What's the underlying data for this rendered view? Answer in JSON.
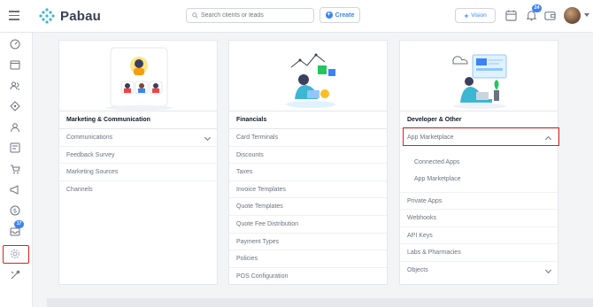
{
  "app": {
    "name": "Pabau"
  },
  "header": {
    "search_placeholder": "Search clients or leads",
    "create_label": "Create",
    "vision_label": "Vision",
    "notification_count": "24",
    "icons": [
      "menu-icon",
      "calendar-icon",
      "bell-icon",
      "wallet-icon",
      "avatar"
    ]
  },
  "sidebar": {
    "items": [
      "dashboard-icon",
      "calendar-icon",
      "clients-icon",
      "marketing-icon",
      "staff-icon",
      "reports-icon",
      "cart-icon",
      "megaphone-icon",
      "finance-icon",
      "inbox-icon",
      "settings-icon",
      "tools-icon"
    ],
    "inbox_badge": "17"
  },
  "cards": [
    {
      "title": "Marketing & Communication",
      "items": [
        {
          "label": "Communications",
          "expandable": "down"
        },
        {
          "label": "Feedback Survey"
        },
        {
          "label": "Marketing Sources"
        },
        {
          "label": "Channels"
        }
      ]
    },
    {
      "title": "Financials",
      "items": [
        {
          "label": "Card Terminals"
        },
        {
          "label": "Discounts"
        },
        {
          "label": "Taxes"
        },
        {
          "label": "Invoice Templates"
        },
        {
          "label": "Quote Templates"
        },
        {
          "label": "Quote Fee Distribution"
        },
        {
          "label": "Payment Types"
        },
        {
          "label": "Policies"
        },
        {
          "label": "POS Configuration"
        }
      ]
    },
    {
      "title": "Developer & Other",
      "items": [
        {
          "label": "App Marketplace",
          "expandable": "up"
        },
        {
          "label": "Connected Apps"
        },
        {
          "label": "App Marketplace"
        },
        {
          "label": "Private Apps"
        },
        {
          "label": "Webhooks"
        },
        {
          "label": "API Keys"
        },
        {
          "label": "Labs & Pharmacies"
        },
        {
          "label": "Objects",
          "expandable": "down"
        }
      ]
    }
  ],
  "colors": {
    "accent": "#3b82f6",
    "highlight": "#e11d1d"
  }
}
